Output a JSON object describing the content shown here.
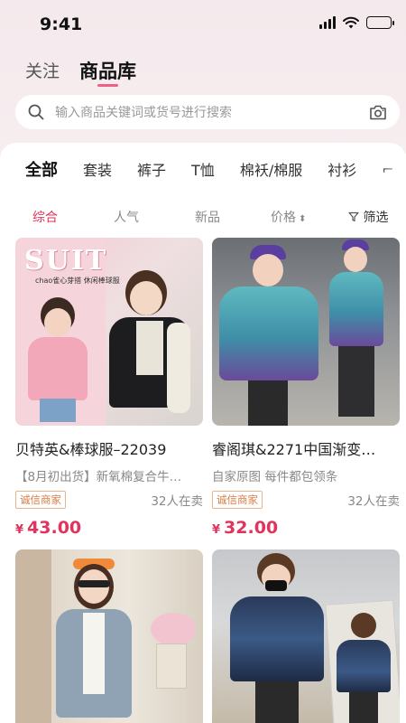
{
  "status_bar": {
    "time": "9:41"
  },
  "top_tabs": [
    {
      "label": "关注",
      "active": false
    },
    {
      "label": "商品库",
      "active": true
    }
  ],
  "search": {
    "placeholder": "输入商品关键词或货号进行搜索"
  },
  "categories": [
    "全部",
    "套装",
    "裤子",
    "T恤",
    "棉袄/棉服",
    "衬衫"
  ],
  "sort": {
    "items": [
      "综合",
      "人气",
      "新品",
      "价格"
    ],
    "filter_label": "筛选",
    "active": "综合"
  },
  "products": [
    {
      "title": "贝特英&棒球服–22039",
      "subtitle": "【8月初出货】新氧棉复合牛…",
      "badge": "诚信商家",
      "sales": "32人在卖",
      "currency": "¥",
      "price": "43.00",
      "banner_big": "SUIT",
      "banner_small": "chao雀心芽搭  休闲棒球服"
    },
    {
      "title": "睿阁琪&2271中国渐变…",
      "subtitle": "自家原图 每件都包领条",
      "badge": "诚信商家",
      "sales": "32人在卖",
      "currency": "¥",
      "price": "32.00"
    },
    {
      "title": "",
      "subtitle": ""
    },
    {
      "title": "",
      "subtitle": ""
    }
  ],
  "colors": {
    "accent": "#e0335e",
    "tab_underline": "#ee5f86",
    "badge": "#d97c43"
  }
}
